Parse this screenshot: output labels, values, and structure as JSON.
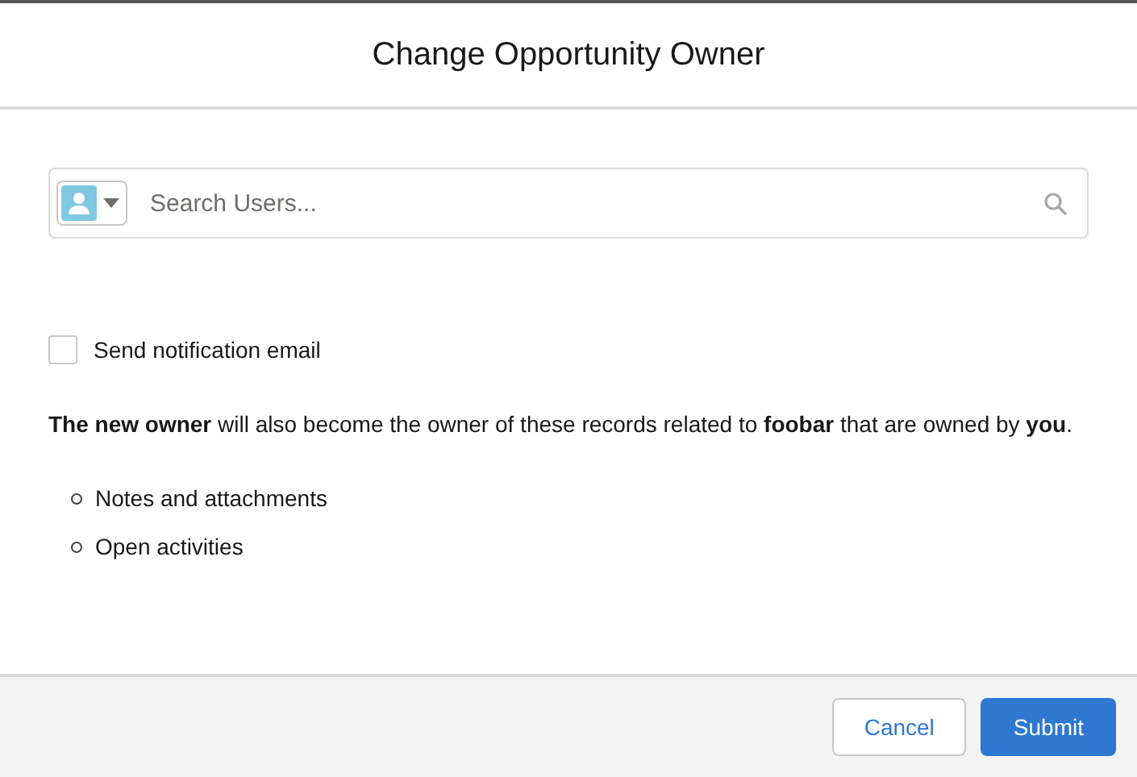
{
  "modal": {
    "title": "Change Opportunity Owner"
  },
  "search": {
    "placeholder": "Search Users..."
  },
  "notify": {
    "label": "Send notification email",
    "checked": false
  },
  "message": "**The new owner** will also become the owner of these records related to **foobar** that are owned by **you**.",
  "related": [
    "Notes and attachments",
    "Open activities"
  ],
  "buttons": [
    {
      "label": "Cancel",
      "kind": "neutral"
    },
    {
      "label": "Submit",
      "kind": "brand"
    }
  ]
}
